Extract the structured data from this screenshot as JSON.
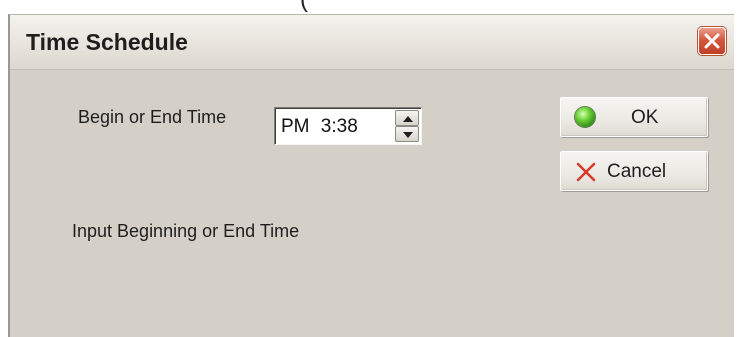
{
  "window": {
    "title": "Time Schedule",
    "close_icon": "close-icon"
  },
  "top_fragment": "(",
  "form": {
    "time_label": "Begin or End Time",
    "time_value": "PM  3:38",
    "hint_text": "Input Beginning or End Time"
  },
  "buttons": {
    "ok_label": "OK",
    "cancel_label": "Cancel"
  },
  "colors": {
    "dialog_bg": "#d4d0c8",
    "close_button": "#d4593f",
    "ok_indicator": "#6fd53a",
    "cancel_icon": "#d83a2a"
  }
}
